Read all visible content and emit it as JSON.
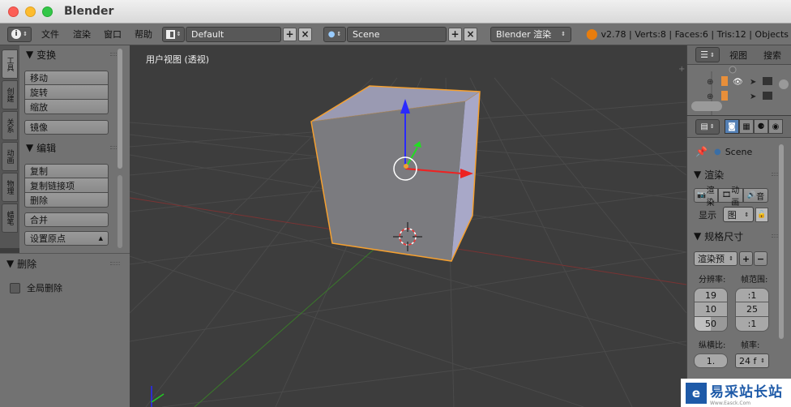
{
  "window": {
    "title": "Blender"
  },
  "info_header": {
    "menus": [
      "文件",
      "渲染",
      "窗口",
      "帮助"
    ],
    "layout_name": "Default",
    "scene_name": "Scene",
    "render_engine": "Blender 渲染",
    "stats": "v2.78 | Verts:8 | Faces:6 | Tris:12 | Objects"
  },
  "left_tabs": [
    "工具",
    "创建",
    "关系",
    "动画",
    "物理",
    "蜡笔"
  ],
  "tool_panel": {
    "transform": {
      "title": "变换",
      "buttons": [
        "移动",
        "旋转",
        "缩放"
      ],
      "mirror": "镜像"
    },
    "edit": {
      "title": "编辑",
      "buttons": [
        "复制",
        "复制链接项",
        "删除"
      ],
      "join": "合并",
      "origin": "设置原点"
    }
  },
  "operator_panel": {
    "title": "删除",
    "option": "全局删除"
  },
  "viewport": {
    "label": "用户视图 (透视)"
  },
  "outliner": {
    "tabs": [
      "视图",
      "搜索"
    ]
  },
  "properties": {
    "context": "Scene",
    "render_panel": {
      "title": "渲染",
      "buttons": [
        "渲染",
        "动画",
        "音"
      ],
      "display_label": "显示",
      "display_value": "图"
    },
    "dimensions_panel": {
      "title": "规格尺寸",
      "preset": "渲染预",
      "resolution_label": "分辨率:",
      "frame_range_label": "帧范围:",
      "resolution_values": [
        "19",
        "10",
        "50"
      ],
      "frame_values": [
        ":1",
        "25",
        ":1"
      ],
      "aspect_label": "纵横比:",
      "framerate_label": "帧率:",
      "aspect_value": "1.",
      "framerate_value": "24 f"
    }
  },
  "watermark": {
    "text": "易采站长站",
    "sub": "Www.Easck.Com"
  }
}
